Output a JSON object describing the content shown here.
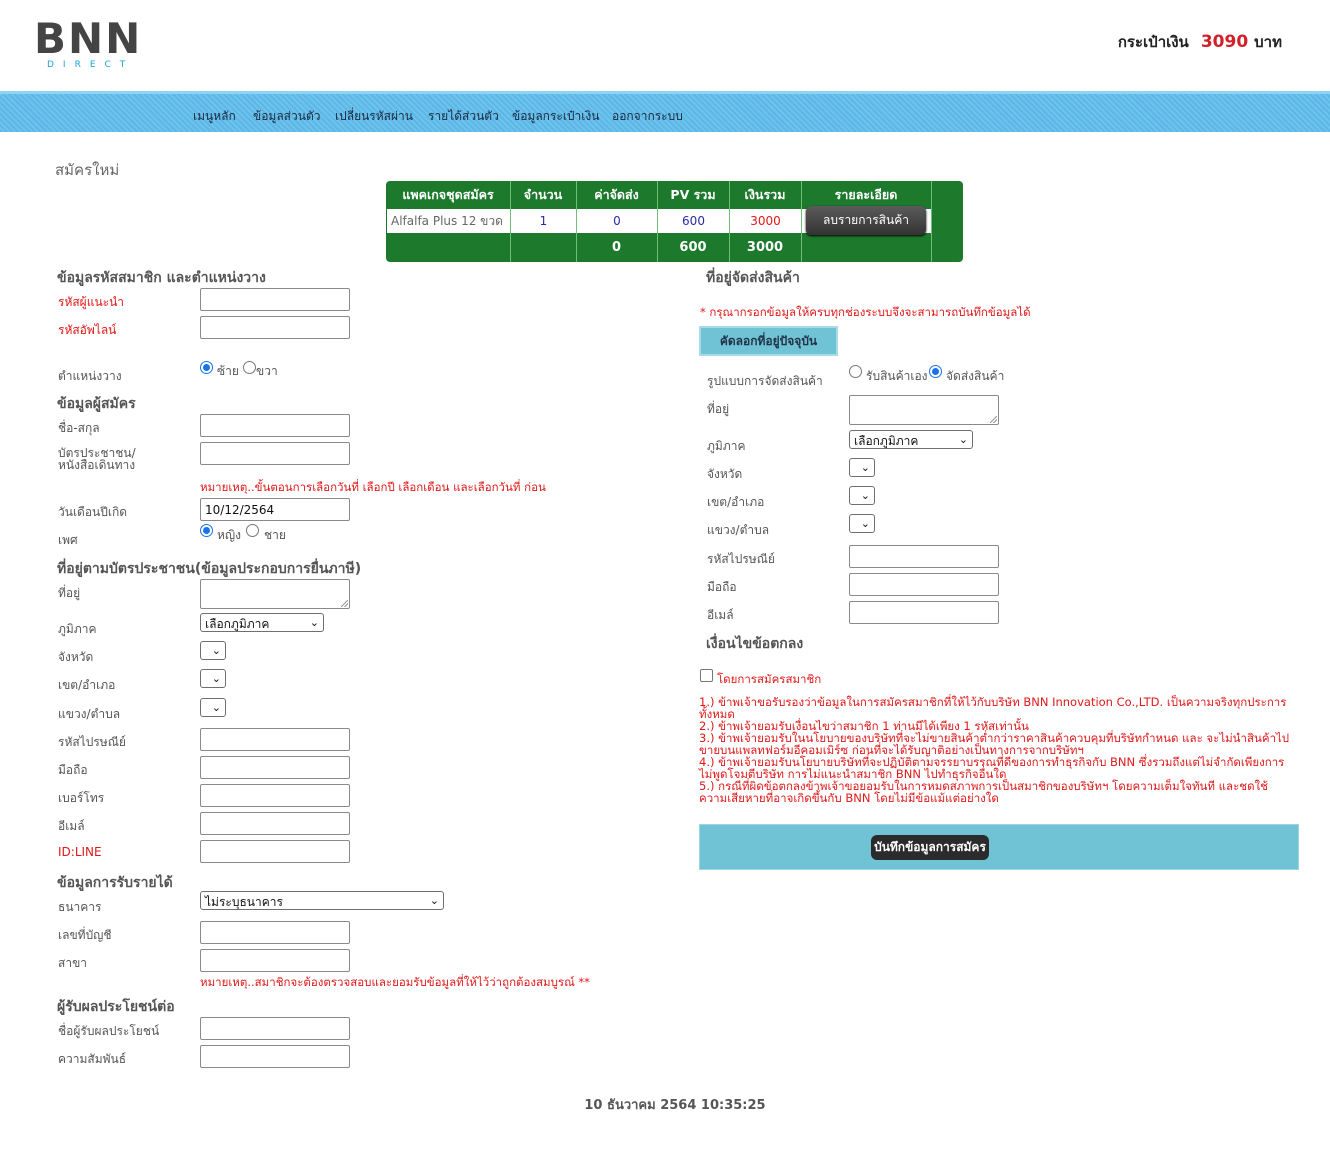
{
  "header": {
    "logo_text": "BNN",
    "logo_sub": "DIRECT",
    "wallet_label": "กระเป๋าเงิน",
    "wallet_amount": "3090",
    "wallet_unit": "บาท"
  },
  "nav": [
    "เมนูหลัก",
    "ข้อมูลส่วนตัว",
    "เปลี่ยนรหัสผ่าน",
    "รายได้ส่วนตัว",
    "ข้อมูลกระเป๋าเงิน",
    "ออกจากระบบ"
  ],
  "page_title": "สมัครใหม่",
  "package_table": {
    "headers": [
      "แพคเกจชุดสมัคร",
      "จำนวน",
      "ค่าจัดส่ง",
      "PV รวม",
      "เงินรวม",
      "รายละเอียด"
    ],
    "row": {
      "name": "Alfalfa Plus 12 ขวด",
      "qty": "1",
      "shipping": "0",
      "pv": "600",
      "total": "3000",
      "delete_label": "ลบรายการสินค้า"
    },
    "footer": {
      "shipping": "0",
      "pv": "600",
      "total": "3000"
    }
  },
  "left": {
    "sec_member": "ข้อมูลรหัสสมาชิก และตำแหน่งวาง",
    "lbl_sponsor": "รหัสผู้แนะนำ",
    "lbl_upline": "รหัสอัพไลน์",
    "lbl_position": "ตำแหน่งวาง",
    "pos_left": "ซ้าย",
    "pos_right": "ขวา",
    "sec_applicant": "ข้อมูลผู้สมัคร",
    "lbl_name": "ชื่อ-สกุล",
    "lbl_idcard_1": "บัตรประชาชน/",
    "lbl_idcard_2": "หนังสือเดินทาง",
    "note_date": "หมายเหตุ..ขั้นตอนการเลือกวันที่ เลือกปี เลือกเดือน และเลือกวันที่ ก่อน",
    "lbl_birth": "วันเดือนปีเกิด",
    "birth_value": "10/12/2564",
    "lbl_gender": "เพศ",
    "gender_f": "หญิง",
    "gender_m": "ชาย",
    "sec_address": "ที่อยู่ตามบัตรประชาชน(ข้อมูลประกอบการยื่นภาษี)",
    "lbl_address": "ที่อยู่",
    "lbl_region": "ภูมิภาค",
    "region_value": "เลือกภูมิภาค",
    "lbl_province": "จังหวัด",
    "lbl_district": "เขต/อำเภอ",
    "lbl_subdistrict": "แขวง/ตำบล",
    "lbl_postcode": "รหัสไปรษณีย์",
    "lbl_mobile": "มือถือ",
    "lbl_phone": "เบอร์โทร",
    "lbl_email": "อีเมล์",
    "lbl_line": "ID:LINE",
    "sec_income": "ข้อมูลการรับรายได้",
    "lbl_bank": "ธนาคาร",
    "bank_value": "ไม่ระบุธนาคาร",
    "lbl_account": "เลขที่บัญชี",
    "lbl_branch": "สาขา",
    "note_verify": "หมายเหตุ..สมาชิกจะต้องตรวจสอบและยอมรับข้อมูลที่ให้ไว้ว่าถูกต้องสมบูรณ์ **",
    "sec_beneficiary": "ผู้รับผลประโยชน์ต่อ",
    "lbl_beneficiary": "ชื่อผู้รับผลประโยชน์",
    "lbl_relation": "ความสัมพันธ์"
  },
  "right": {
    "sec_shipping": "ที่อยู่จัดส่งสินค้า",
    "note_required": "* กรุณากรอกข้อมูลให้ครบทุกช่องระบบจึงจะสามารถบันทึกข้อมูลได้",
    "copy_label": "คัดลอกที่อยู่ปัจจุบัน",
    "lbl_delivery": "รูปแบบการจัดส่งสินค้า",
    "opt_pickup": "รับสินค้าเอง",
    "opt_ship": "จัดส่งสินค้า",
    "lbl_address": "ที่อยู่",
    "lbl_region": "ภูมิภาค",
    "region_value": "เลือกภูมิภาค",
    "lbl_province": "จังหวัด",
    "lbl_district": "เขต/อำเภอ",
    "lbl_subdistrict": "แขวง/ตำบล",
    "lbl_postcode": "รหัสไปรษณีย์",
    "lbl_mobile": "มือถือ",
    "lbl_email": "อีเมล์",
    "sec_terms": "เงื่อนไขข้อตกลง",
    "agree_label": "โดยการสมัครสมาชิก",
    "terms": [
      "1.) ข้าพเจ้าขอรับรองว่าข้อมูลในการสมัครสมาชิกที่ให้ไว้กับบริษัท BNN Innovation Co.,LTD. เป็นความจริงทุกประการ",
      "ทั้งหมด",
      "2.) ข้าพเจ้ายอมรับเงื่อนไขว่าสมาชิก 1 ท่านมีได้เพียง 1 รหัสเท่านั้น",
      "3.) ข้าพเจ้ายอมรับในนโยบายของบริษัทที่จะไม่ขายสินค้าต่ำกว่าราคาสินค้าควบคุมที่บริษัทกำหนด และ จะไม่นำสินค้าไป",
      "ขายบนแพลทฟอร์มอีคอมเมิร์ซ ก่อนที่จะได้รับญาติอย่างเป็นทางการจากบริษัทฯ",
      "4.) ข้าพเจ้ายอมรับนโยบายบริษัทที่จะปฏิบัติตามจรรยาบรรณที่ดีของการทำธุรกิจกับ BNN ซึ่งรวมถึงแต่ไม่จำกัดเพียงการ",
      "ไม่พูดโจมตีบริษัท การไม่แนะนำสมาชิก BNN ไปทำธุรกิจอื่นใด",
      "5.) กรณีที่ผิดข้อตกลงข้าพเจ้าขอยอมรับในการหมดสภาพการเป็นสมาชิกของบริษัทฯ โดยความเต็มใจทันที และชดใช้",
      "ความเสียหายที่อาจเกิดขึ้นกับ BNN โดยไม่มีข้อแม้แต่อย่างใด"
    ],
    "save_label": "บันทึกข้อมูลการสมัคร"
  },
  "footer": {
    "datetime": "10 ธันวาคม 2564 10:35:25"
  },
  "colors": {
    "nav_blue": "#5bb8e6",
    "table_green": "#1d7a2d",
    "accent_red": "#e01818",
    "panel_cyan": "#6fc3d4"
  }
}
